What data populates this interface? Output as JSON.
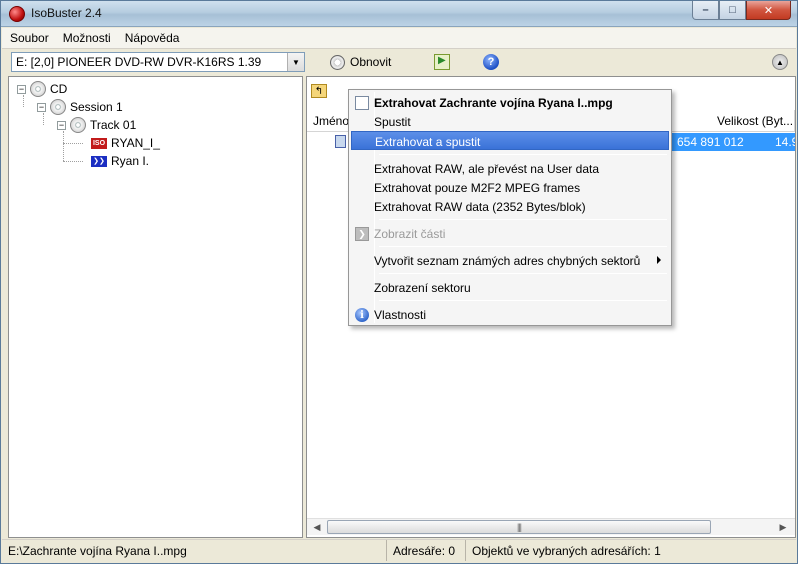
{
  "window": {
    "title": "IsoBuster 2.4"
  },
  "menubar": {
    "items": [
      "Soubor",
      "Možnosti",
      "Nápověda"
    ]
  },
  "toolbar": {
    "drive": "E: [2,0]  PIONEER   DVD-RW DVR-K16RS  1.39",
    "refresh_label": "Obnovit"
  },
  "tree": {
    "cd": "CD",
    "session": "Session 1",
    "track": "Track 01",
    "iso_entry": "RYAN_I_",
    "mpg_entry": "Ryan I.",
    "iso_badge": "ISO"
  },
  "list": {
    "col_name": "Jméno",
    "col_size": "Velikost (Byt...",
    "row": {
      "size": "654 891 012",
      "extra": "14.9"
    }
  },
  "context_menu": {
    "items": [
      {
        "label": "Extrahovat Zachrante vojína Ryana I..mpg",
        "style": "bold"
      },
      {
        "label": "Spustit"
      },
      {
        "label": "Extrahovat a spustit",
        "style": "highlighted"
      },
      {
        "label": "Extrahovat RAW, ale převést na User data"
      },
      {
        "label": "Extrahovat pouze M2F2 MPEG frames"
      },
      {
        "label": "Extrahovat RAW data (2352 Bytes/blok)"
      },
      {
        "label": "Zobrazit části",
        "style": "disabled"
      },
      {
        "label": "Vytvořit seznam známých adres chybných sektorů",
        "submenu": true
      },
      {
        "label": "Zobrazení sektoru"
      },
      {
        "label": "Vlastnosti"
      }
    ]
  },
  "statusbar": {
    "path": "E:\\Zachrante vojína Ryana I..mpg",
    "folders": "Adresáře: 0",
    "objects": "Objektů ve vybraných adresářích: 1"
  },
  "colors": {
    "highlight": "#3a72d8",
    "selection": "#3399ff",
    "close_button": "#c23a22"
  }
}
